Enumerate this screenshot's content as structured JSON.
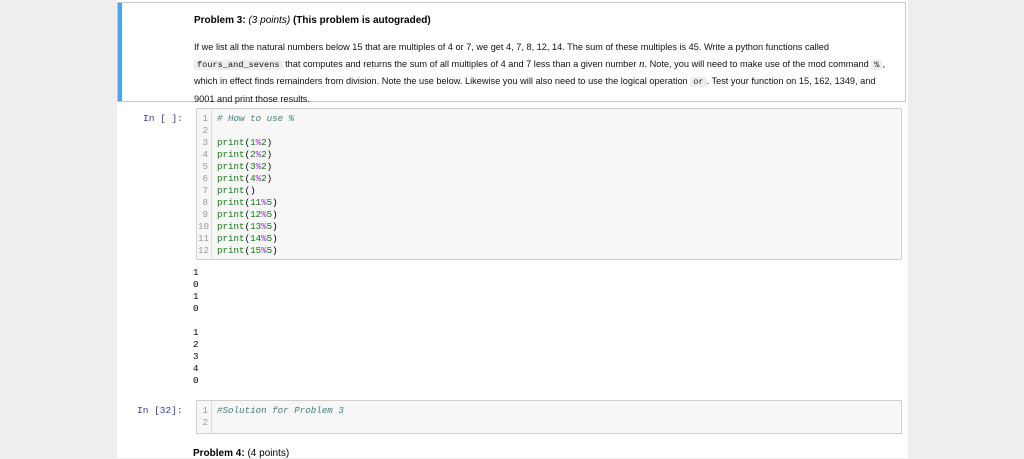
{
  "problem3": {
    "label": "Problem 3:",
    "points": "(3 points)",
    "note": "(This problem is autograded)",
    "p1_a": "If we list all the natural numbers below 15 that are multiples of 4 or 7, we get 4, 7, 8, 12, 14. The sum of these multiples is 45. Write a python functions called",
    "p1_code": "fours_and_sevens",
    "p1_b": "that computes and returns the sum of all multiples of 4 and 7 less than a given number",
    "p1_var": "n",
    "p1_c": ". Note, you will need to make use of the mod",
    "p2_a": "command",
    "p2_code": "%",
    "p2_b": ", which in effect finds remainders from division. Note the use below. Likewise you will also need to use the logical operation",
    "p2_code2": "or",
    "p2_c": ". Test your",
    "p3": "function on 15, 162, 1349, and 9001 and print those results."
  },
  "cell1": {
    "prompt": "In [ ]:",
    "lines": [
      {
        "n": "1",
        "comment": "# How to use %"
      },
      {
        "n": "2"
      },
      {
        "n": "3",
        "a": "1",
        "b": "2"
      },
      {
        "n": "4",
        "a": "2",
        "b": "2"
      },
      {
        "n": "5",
        "a": "3",
        "b": "2"
      },
      {
        "n": "6",
        "a": "4",
        "b": "2"
      },
      {
        "n": "7",
        "empty": true
      },
      {
        "n": "8",
        "a": "11",
        "b": "5"
      },
      {
        "n": "9",
        "a": "12",
        "b": "5"
      },
      {
        "n": "10",
        "a": "13",
        "b": "5"
      },
      {
        "n": "11",
        "a": "14",
        "b": "5"
      },
      {
        "n": "12",
        "a": "15",
        "b": "5"
      }
    ],
    "output": [
      "1",
      "0",
      "1",
      "0",
      "",
      "1",
      "2",
      "3",
      "4",
      "0"
    ]
  },
  "cell2": {
    "prompt": "In [32]:",
    "lines": [
      {
        "n": "1",
        "comment": "#Solution for Problem 3"
      },
      {
        "n": "2"
      }
    ]
  },
  "problem4": {
    "label": "Problem 4:",
    "points": "(4 points)"
  },
  "syntax": {
    "fn": "print",
    "op": "%"
  },
  "colors": {
    "accent_bar": "#42a5f5",
    "prompt": "#303f9f",
    "builtin": "#008000",
    "operator": "#aa22ff",
    "comment": "#408080"
  }
}
